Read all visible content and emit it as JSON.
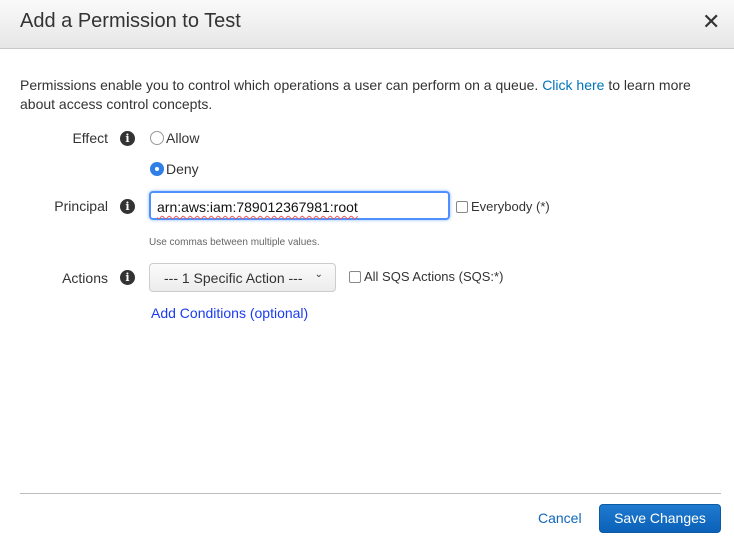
{
  "dialog": {
    "title": "Add a Permission to Test",
    "close_label": "✕"
  },
  "intro": {
    "text_before": "Permissions enable you to control which operations a user can perform on a queue. ",
    "link": "Click here",
    "text_after": " to learn more about access control concepts."
  },
  "effect": {
    "label": "Effect",
    "options": [
      {
        "label": "Allow",
        "selected": false
      },
      {
        "label": "Deny",
        "selected": true
      }
    ]
  },
  "principal": {
    "label": "Principal",
    "value": "arn:aws:iam:789012367981:root",
    "everybody_label": "Everybody (*)",
    "everybody_checked": false,
    "hint": "Use commas between multiple values."
  },
  "actions": {
    "label": "Actions",
    "selected": "--- 1 Specific Action ---",
    "all_label": "All SQS Actions (SQS:*)",
    "all_checked": false
  },
  "add_conditions": "Add Conditions (optional)",
  "footer": {
    "cancel": "Cancel",
    "save": "Save Changes"
  },
  "info_glyph": "i"
}
